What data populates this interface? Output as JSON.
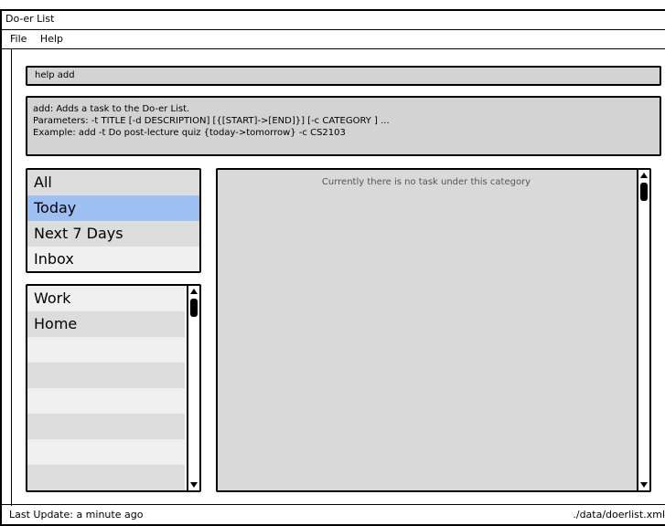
{
  "window": {
    "title": "Do-er List"
  },
  "menu": {
    "items": [
      "File",
      "Help"
    ]
  },
  "command": {
    "value": "help add"
  },
  "help": {
    "lines": [
      "add: Adds a task to the Do-er List.",
      "Parameters: -t TITLE [-d DESCRIPTION] [{[START]->[END]}] [-c CATEGORY ] ...",
      "Example: add -t Do post-lecture quiz {today->tomorrow} -c CS2103"
    ]
  },
  "categories": {
    "selected_index": 1,
    "items": [
      "All",
      "Today",
      "Next 7 Days",
      "Inbox"
    ]
  },
  "projects": {
    "items": [
      "Work",
      "Home",
      "",
      "",
      "",
      "",
      "",
      ""
    ]
  },
  "tasks": {
    "empty_message": "Currently there is no task under this category"
  },
  "status": {
    "last_update": "Last Update: a minute ago",
    "file_path": "./data/doerlist.xml"
  },
  "colors": {
    "selected": "#9dbff2",
    "row_light": "#f0f0f0",
    "row_dark": "#dcdcdc",
    "panel_bg": "#d9d9d9"
  }
}
